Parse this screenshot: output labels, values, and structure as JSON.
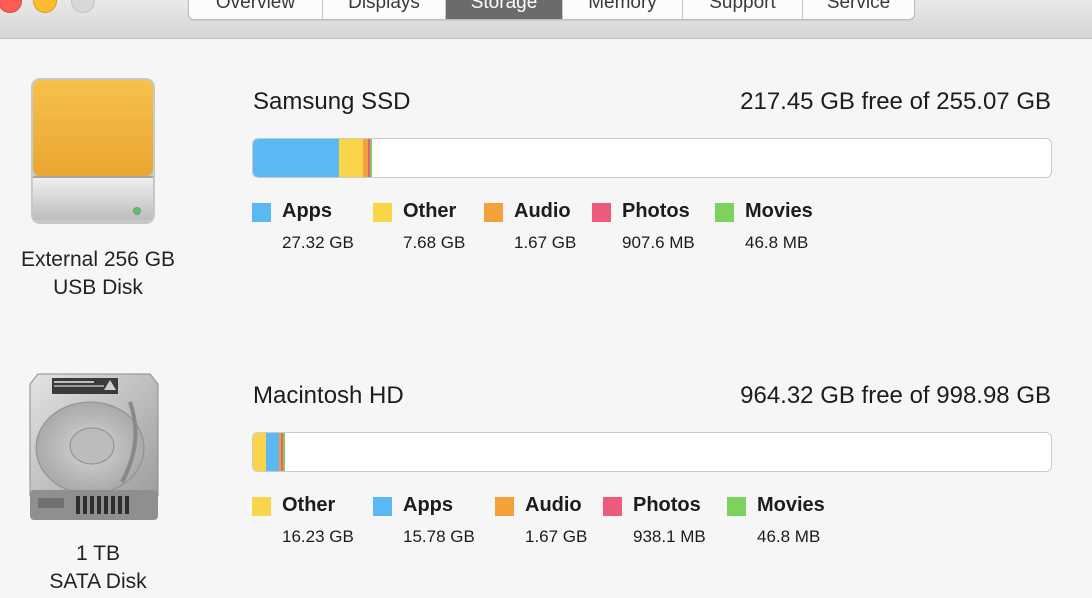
{
  "window": {
    "tabs": [
      {
        "label": "Overview",
        "active": false
      },
      {
        "label": "Displays",
        "active": false
      },
      {
        "label": "Storage",
        "active": true
      },
      {
        "label": "Memory",
        "active": false
      },
      {
        "label": "Support",
        "active": false
      },
      {
        "label": "Service",
        "active": false
      }
    ]
  },
  "colors": {
    "apps": "#5ab8f2",
    "other": "#fad54a",
    "audio": "#f4a13a",
    "photos": "#ec5a7c",
    "movies": "#7bd35b",
    "active_tab": "#6b6b6b"
  },
  "disks": [
    {
      "icon": "external-drive-icon",
      "caption_line1": "External 256 GB",
      "caption_line2": "USB Disk",
      "name": "Samsung SSD",
      "free_text": "217.45 GB free of 255.07 GB",
      "capacity_gb": 255.07,
      "categories": [
        {
          "key": "apps",
          "label": "Apps",
          "size": "27.32 GB",
          "gb": 27.32
        },
        {
          "key": "other",
          "label": "Other",
          "size": "7.68 GB",
          "gb": 7.68
        },
        {
          "key": "audio",
          "label": "Audio",
          "size": "1.67 GB",
          "gb": 1.67
        },
        {
          "key": "photos",
          "label": "Photos",
          "size": "907.6 MB",
          "gb": 0.9076
        },
        {
          "key": "movies",
          "label": "Movies",
          "size": "46.8 MB",
          "gb": 0.0468
        }
      ]
    },
    {
      "icon": "internal-hard-drive-icon",
      "caption_line1": "1 TB",
      "caption_line2": "SATA Disk",
      "name": "Macintosh HD",
      "free_text": "964.32 GB free of 998.98 GB",
      "capacity_gb": 998.98,
      "categories": [
        {
          "key": "other",
          "label": "Other",
          "size": "16.23 GB",
          "gb": 16.23
        },
        {
          "key": "apps",
          "label": "Apps",
          "size": "15.78 GB",
          "gb": 15.78
        },
        {
          "key": "audio",
          "label": "Audio",
          "size": "1.67 GB",
          "gb": 1.67
        },
        {
          "key": "photos",
          "label": "Photos",
          "size": "938.1 MB",
          "gb": 0.9381
        },
        {
          "key": "movies",
          "label": "Movies",
          "size": "46.8 MB",
          "gb": 0.0468
        }
      ]
    }
  ]
}
